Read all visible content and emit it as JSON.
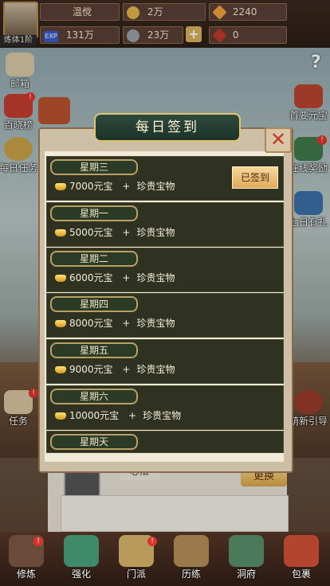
{
  "header": {
    "player_name": "温傥",
    "realm": "炼体1阶",
    "exp_tag": "EXP",
    "exp_value": "131万",
    "gold": "2万",
    "diamond": "2240",
    "power": "23万",
    "tokens": "0",
    "plus_icon": "+"
  },
  "left_sidebar": [
    {
      "label": "邮箱",
      "icon": "mailbox-icon"
    },
    {
      "label": "百晓榜",
      "icon": "ranking-icon"
    },
    {
      "label": "每日任务",
      "icon": "daily-task-icon"
    },
    {
      "label": "任务",
      "icon": "quest-icon"
    }
  ],
  "right_sidebar": [
    {
      "label": "?",
      "icon": "help-icon"
    },
    {
      "label": "首要元宝",
      "icon": "treasure-icon"
    },
    {
      "label": "在线奖励",
      "icon": "online-reward-icon"
    },
    {
      "label": "七日有礼",
      "icon": "seven-day-gift-icon"
    },
    {
      "label": "萌新引导",
      "icon": "newbie-guide-icon"
    }
  ],
  "background_panel": {
    "label": "心法",
    "change_button": "更换"
  },
  "modal": {
    "title": "每日签到",
    "close_icon": "✕",
    "signed_label": "已签到",
    "plus": "+",
    "rows": [
      {
        "day": "星期三",
        "ingots": "7000元宝",
        "bonus": "珍贵宝物",
        "signed": true
      },
      {
        "day": "星期一",
        "ingots": "5000元宝",
        "bonus": "珍贵宝物",
        "signed": false
      },
      {
        "day": "星期二",
        "ingots": "6000元宝",
        "bonus": "珍贵宝物",
        "signed": false
      },
      {
        "day": "星期四",
        "ingots": "8000元宝",
        "bonus": "珍贵宝物",
        "signed": false
      },
      {
        "day": "星期五",
        "ingots": "9000元宝",
        "bonus": "珍贵宝物",
        "signed": false
      },
      {
        "day": "星期六",
        "ingots": "10000元宝",
        "bonus": "珍贵宝物",
        "signed": false
      },
      {
        "day": "星期天",
        "ingots": "",
        "bonus": "",
        "signed": false
      }
    ]
  },
  "bottom_nav": [
    {
      "label": "修炼",
      "icon": "cultivate-icon"
    },
    {
      "label": "强化",
      "icon": "enhance-icon"
    },
    {
      "label": "门派",
      "icon": "sect-icon"
    },
    {
      "label": "历练",
      "icon": "training-icon"
    },
    {
      "label": "洞府",
      "icon": "cave-house-icon"
    },
    {
      "label": "包裹",
      "icon": "bag-icon"
    }
  ],
  "colors": {
    "modal_row_bg": "#2f3221",
    "title_banner_bg": "#1c3328",
    "badge_red": "#d9342b",
    "gold_accent": "#e2c46e"
  }
}
